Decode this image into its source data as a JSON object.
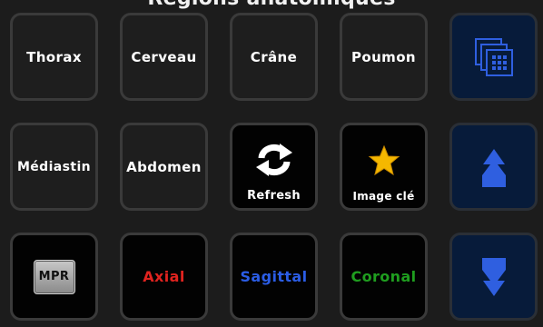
{
  "header": {
    "title": "Regions anatomiques"
  },
  "buttons": [
    {
      "label": "Thorax"
    },
    {
      "label": "Cerveau"
    },
    {
      "label": "Crâne"
    },
    {
      "label": "Poumon"
    },
    {
      "icon": "grid-layout-icon"
    },
    {
      "label": "Médiastin"
    },
    {
      "label": "Abdomen"
    },
    {
      "label": "Refresh",
      "icon": "refresh-icon"
    },
    {
      "label": "Image clé",
      "icon": "star-icon"
    },
    {
      "icon": "arrow-up-icon"
    },
    {
      "label": "MPR"
    },
    {
      "label": "Axial",
      "color": "#e0231f"
    },
    {
      "label": "Sagittal",
      "color": "#2b5de6"
    },
    {
      "label": "Coronal",
      "color": "#1f9e1f"
    },
    {
      "icon": "arrow-down-icon"
    }
  ],
  "colors": {
    "nav_accent": "#2f5fe0",
    "star": "#f5b800"
  }
}
